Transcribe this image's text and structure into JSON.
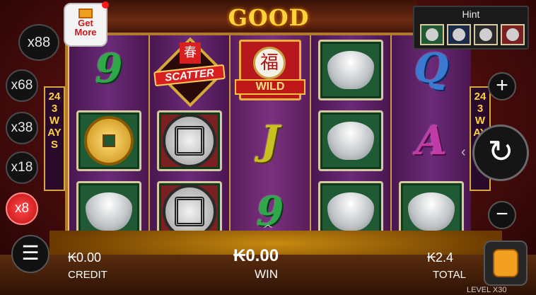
{
  "game_title": "GOOD FORTUNE",
  "gift": {
    "label_line1": "Get",
    "label_line2": "More"
  },
  "multipliers": [
    {
      "label": "x88",
      "active": false
    },
    {
      "label": "x68",
      "active": false
    },
    {
      "label": "x38",
      "active": false
    },
    {
      "label": "x18",
      "active": false
    },
    {
      "label": "x8",
      "active": true
    }
  ],
  "ways_banner": "243 WAYS",
  "hint": {
    "title": "Hint"
  },
  "reels": [
    [
      "9",
      "coin",
      "ingot"
    ],
    [
      "scatter",
      "medal",
      "medal"
    ],
    [
      "wild",
      "J",
      "9"
    ],
    [
      "ingot",
      "ingot",
      "ingot"
    ],
    [
      "Q",
      "A",
      "ingot"
    ]
  ],
  "symbols": {
    "scatter_label": "SCATTER",
    "scatter_char": "春",
    "wild_label": "WILD",
    "wild_char": "福"
  },
  "controls": {
    "plus_icon": "+",
    "minus_icon": "−",
    "spin_icon": "↻",
    "menu_icon": "☰"
  },
  "stats": {
    "credit_value": "₭0.00",
    "credit_label": "CREDIT",
    "win_value": "₭0.00",
    "win_label": "WIN",
    "total_value": "₭2.4",
    "total_label": "TOTAL"
  },
  "level_text": "LEVEL X30"
}
